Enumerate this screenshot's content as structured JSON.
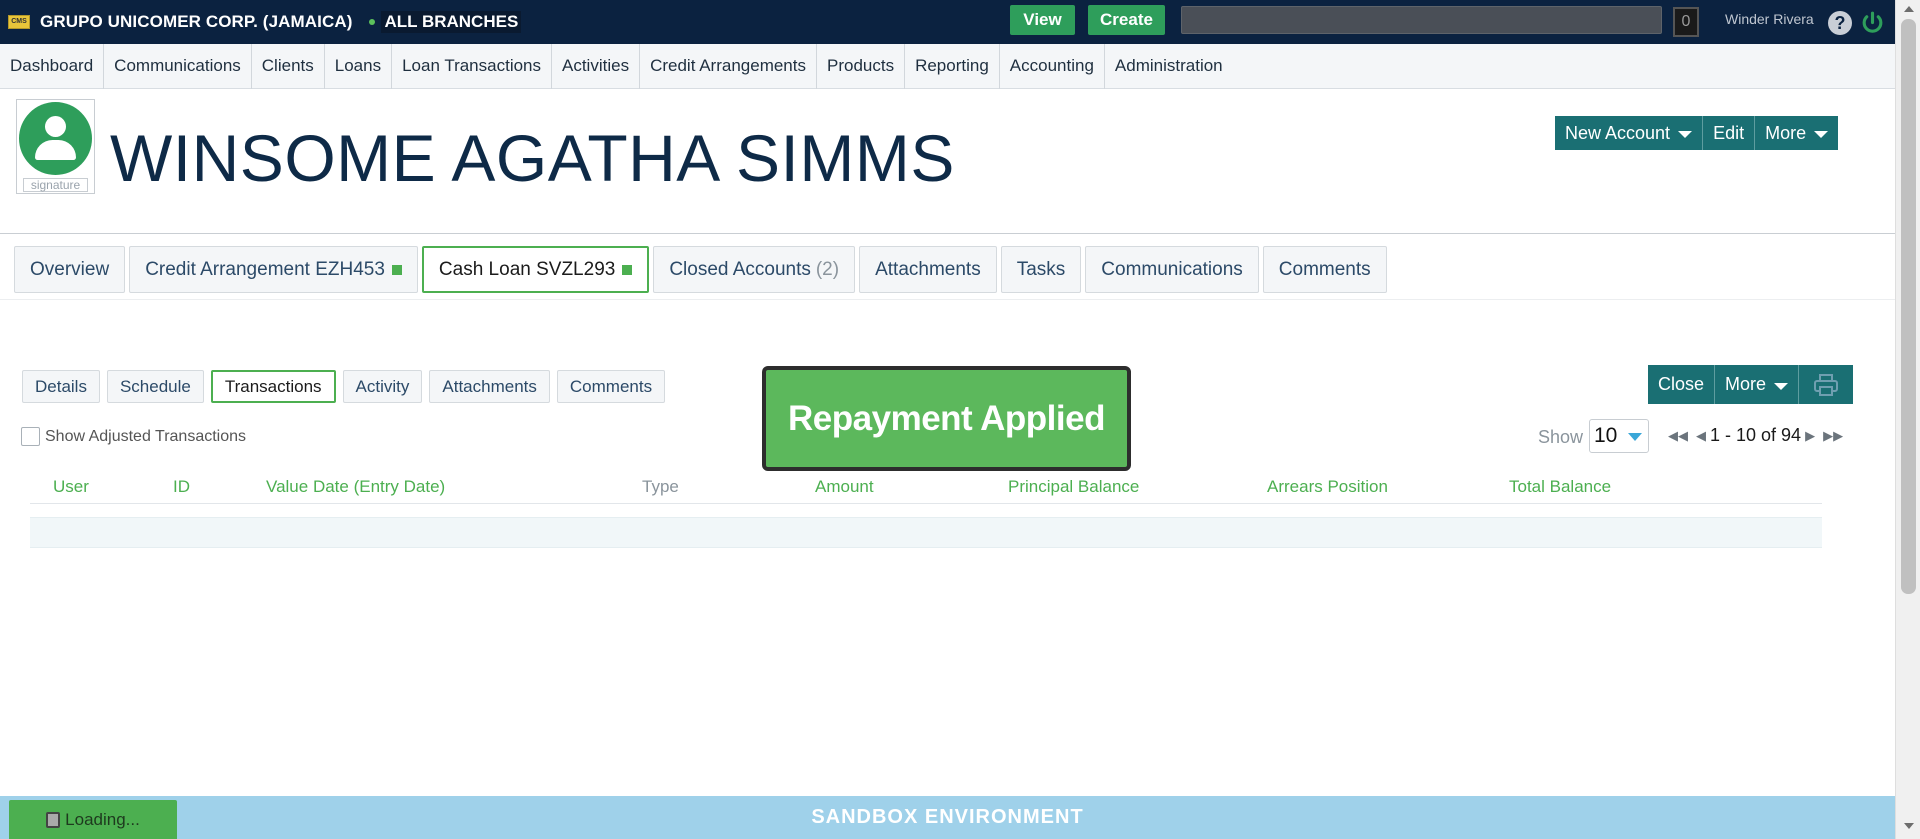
{
  "topbar": {
    "logo_text": "CMS",
    "org_name": "GRUPO UNICOMER CORP. (JAMAICA)",
    "branch": "ALL BRANCHES",
    "view_label": "View",
    "create_label": "Create",
    "search_placeholder": "",
    "counter": "0",
    "user_name": "Winder Rivera",
    "help_glyph": "?"
  },
  "menu": {
    "items": [
      "Dashboard",
      "Communications",
      "Clients",
      "Loans",
      "Loan Transactions",
      "Activities",
      "Credit Arrangements",
      "Products",
      "Reporting",
      "Accounting",
      "Administration"
    ]
  },
  "client": {
    "avatar_label": "signature",
    "name": "WINSOME AGATHA SIMMS"
  },
  "header_actions": {
    "new_account": "New Account",
    "edit": "Edit",
    "more": "More"
  },
  "main_tabs": {
    "overview": "Overview",
    "credit_arrangement": "Credit Arrangement EZH453",
    "cash_loan": "Cash Loan SVZL293",
    "closed_accounts": "Closed Accounts",
    "closed_count": "(2)",
    "attachments": "Attachments",
    "tasks": "Tasks",
    "communications": "Communications",
    "comments": "Comments"
  },
  "sub_tabs": {
    "details": "Details",
    "schedule": "Schedule",
    "transactions": "Transactions",
    "activity": "Activity",
    "attachments": "Attachments",
    "comments": "Comments"
  },
  "toast": "Repayment Applied",
  "right_actions": {
    "close": "Close",
    "more": "More"
  },
  "show_adjusted": "Show Adjusted Transactions",
  "pager": {
    "show_label": "Show",
    "page_size": "10",
    "range": "1 - 10 of 94"
  },
  "table": {
    "headers": [
      "User",
      "ID",
      "Value Date (Entry Date)",
      "Type",
      "Amount",
      "Principal Balance",
      "Arrears Position",
      "Total Balance"
    ]
  },
  "footer": {
    "sandbox": "SANDBOX ENVIRONMENT",
    "loading": "Loading..."
  },
  "colors": {
    "navy": "#0b2240",
    "teal": "#1a6f73",
    "green": "#4caf50",
    "toast_green": "#5cb85c",
    "footer_blue": "#9fd1ea"
  }
}
